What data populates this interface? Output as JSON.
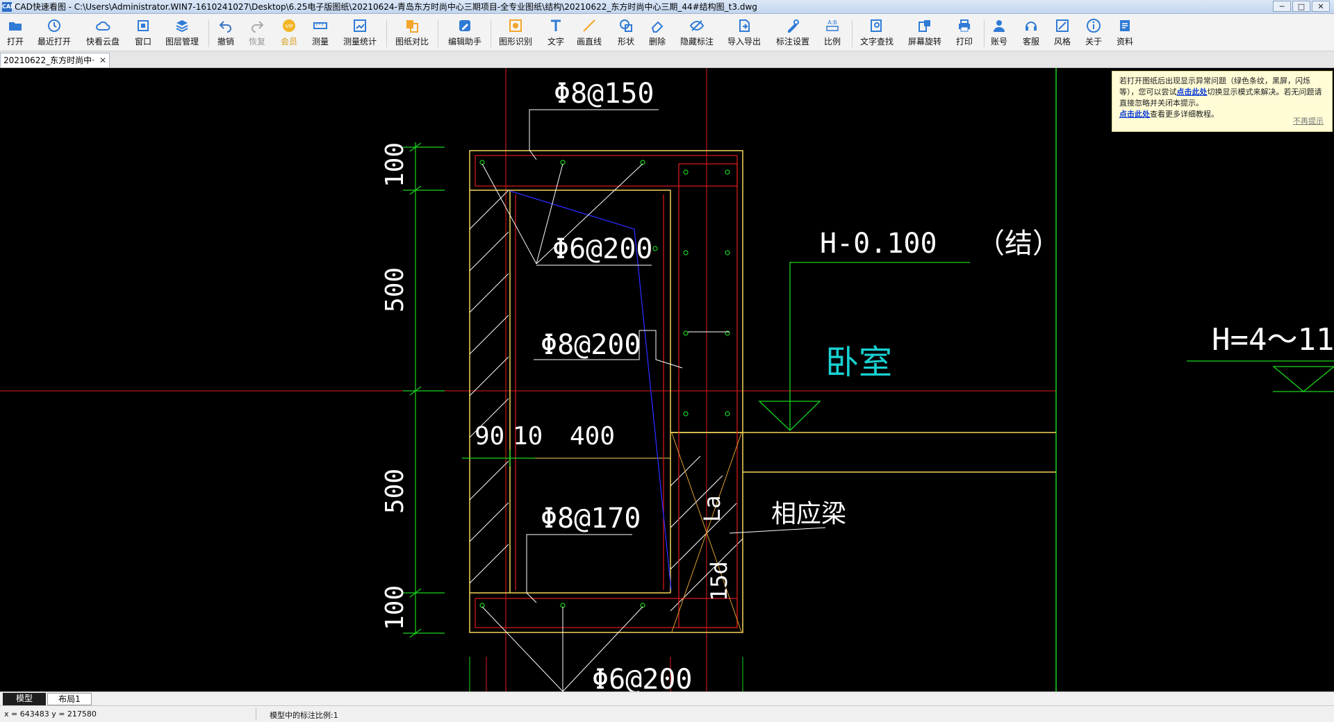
{
  "window": {
    "app_icon_text": "CAD",
    "title": "CAD快速看图 - C:\\Users\\Administrator.WIN7-1610241027\\Desktop\\6.25电子版图纸\\20210624-青岛东方时尚中心三期项目-全专业图纸\\结构\\20210622_东方时尚中心三期_44#结构图_t3.dwg",
    "controls": {
      "minimize": "─",
      "maximize": "□",
      "close": "✕"
    }
  },
  "toolbar": {
    "items": [
      {
        "id": "open",
        "label": "打开"
      },
      {
        "id": "recent",
        "label": "最近打开"
      },
      {
        "id": "cloud",
        "label": "快看云盘"
      },
      {
        "id": "window",
        "label": "窗口"
      },
      {
        "id": "layers",
        "label": "图层管理"
      },
      {
        "id": "undo",
        "label": "撤销"
      },
      {
        "id": "redo",
        "label": "恢复"
      },
      {
        "id": "vip",
        "label": "会员"
      },
      {
        "id": "measure",
        "label": "测量"
      },
      {
        "id": "measure-stats",
        "label": "测量统计"
      },
      {
        "id": "compare",
        "label": "图纸对比"
      },
      {
        "id": "edit-helper",
        "label": "编辑助手"
      },
      {
        "id": "shape-recog",
        "label": "图形识别"
      },
      {
        "id": "text",
        "label": "文字"
      },
      {
        "id": "line",
        "label": "画直线"
      },
      {
        "id": "shape",
        "label": "形状"
      },
      {
        "id": "erase",
        "label": "删除"
      },
      {
        "id": "hide-mark",
        "label": "隐藏标注"
      },
      {
        "id": "import-export",
        "label": "导入导出"
      },
      {
        "id": "mark-settings",
        "label": "标注设置"
      },
      {
        "id": "scale",
        "label": "比例"
      },
      {
        "id": "text-search",
        "label": "文字查找"
      },
      {
        "id": "rotate",
        "label": "屏幕旋转"
      },
      {
        "id": "print",
        "label": "打印"
      },
      {
        "id": "account",
        "label": "账号"
      },
      {
        "id": "service",
        "label": "客服"
      },
      {
        "id": "style",
        "label": "风格"
      },
      {
        "id": "about",
        "label": "关于"
      },
      {
        "id": "resources",
        "label": "资料"
      }
    ]
  },
  "document_tab": {
    "label": "20210622_东方时尚中·",
    "close": "✕"
  },
  "notice": {
    "text1": "若打开图纸后出现显示异常问题（绿色条纹，黑屏，闪烁等），您可以尝试",
    "link1": "点击此处",
    "text2": "切换显示模式来解决。若无问题请直接忽略并关闭本提示。",
    "link2": "点击此处",
    "text3": "查看更多详细教程。",
    "dismiss": "不再提示"
  },
  "drawing": {
    "labels": {
      "top_rebar": "Φ8@150",
      "stirrup": "Φ6@200",
      "middle_rebar": "Φ8@200",
      "lower_rebar": "Φ8@170",
      "bottom_stirrup": "Φ6@200",
      "elevation": "H-0.100",
      "struct_note": "（结）",
      "room": "卧室",
      "beam_note": "相应梁",
      "dim_100_top": "100",
      "dim_500_upper": "500",
      "dim_500_lower": "500",
      "dim_100_bottom": "100",
      "dim_90": "90",
      "dim_10": "10",
      "dim_400": "400",
      "lap_la": "La",
      "lap_15d": "15d",
      "right_elev": "H=4～11"
    },
    "colors": {
      "background": "#000000",
      "red": "#e21b1b",
      "green": "#19d61d",
      "yellow": "#f5d55a",
      "white": "#ffffff",
      "blue": "#2b2bff",
      "cyan": "#19d1d1",
      "orange": "#e0a030"
    }
  },
  "layout_tabs": [
    {
      "label": "模型",
      "active": true
    },
    {
      "label": "布局1",
      "active": false
    }
  ],
  "status": {
    "coords": "x = 643483  y = 217580",
    "scale": "模型中的标注比例:1"
  }
}
